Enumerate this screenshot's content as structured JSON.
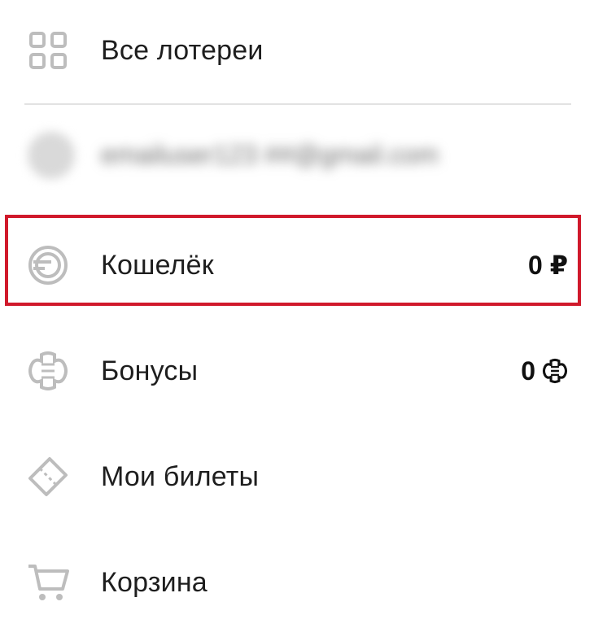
{
  "menu": {
    "all_lotteries": {
      "label": "Все лотереи",
      "icon": "grid-icon"
    },
    "account": {
      "email_blurred": "emailuser123 ##@gmail.com",
      "icon": "avatar"
    },
    "wallet": {
      "label": "Кошелёк",
      "value": "0 ₽",
      "icon": "wallet-icon"
    },
    "bonuses": {
      "label": "Бонусы",
      "value": "0",
      "icon": "bonus-icon"
    },
    "my_tickets": {
      "label": "Мои билеты",
      "icon": "ticket-icon"
    },
    "cart": {
      "label": "Корзина",
      "icon": "cart-icon"
    }
  },
  "colors": {
    "highlight": "#d0192b",
    "icon": "#bdbdbd",
    "text": "#1e1e1e"
  }
}
